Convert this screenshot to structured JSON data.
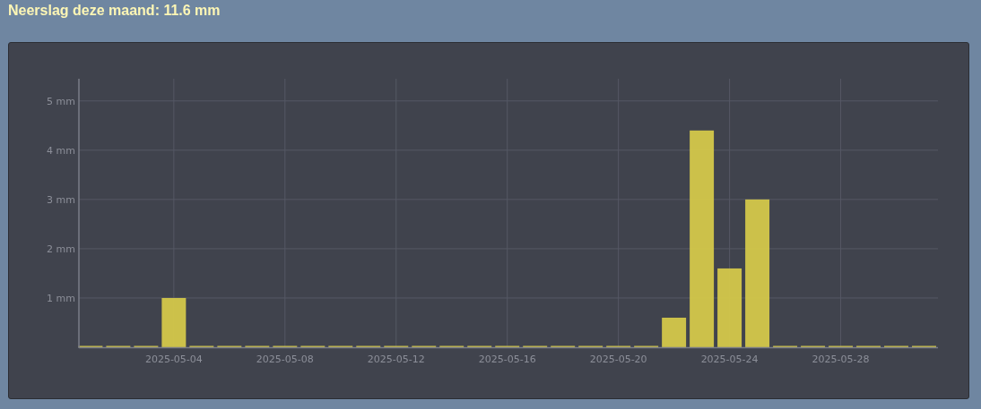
{
  "title": "Neerslag deze maand: 11.6 mm",
  "chart": {
    "chart_data": {
      "type": "bar",
      "x": [
        "2025-05-01",
        "2025-05-02",
        "2025-05-03",
        "2025-05-04",
        "2025-05-05",
        "2025-05-06",
        "2025-05-07",
        "2025-05-08",
        "2025-05-09",
        "2025-05-10",
        "2025-05-11",
        "2025-05-12",
        "2025-05-13",
        "2025-05-14",
        "2025-05-15",
        "2025-05-16",
        "2025-05-17",
        "2025-05-18",
        "2025-05-19",
        "2025-05-20",
        "2025-05-21",
        "2025-05-22",
        "2025-05-23",
        "2025-05-24",
        "2025-05-25",
        "2025-05-26",
        "2025-05-27",
        "2025-05-28",
        "2025-05-29",
        "2025-05-30",
        "2025-05-31"
      ],
      "series": [
        {
          "color": "#d4c84a",
          "values": [
            0,
            0,
            0,
            1.0,
            0,
            0,
            0,
            0,
            0,
            0,
            0,
            0,
            0,
            0,
            0,
            0,
            0,
            0,
            0,
            0,
            0,
            0.6,
            4.4,
            1.6,
            3.0,
            0,
            0,
            0,
            0,
            0,
            0
          ]
        }
      ],
      "ylim": [
        0,
        5.45
      ],
      "yticks": [
        {
          "value": 1,
          "label": "1 mm"
        },
        {
          "value": 2,
          "label": "2 mm"
        },
        {
          "value": 3,
          "label": "3 mm"
        },
        {
          "value": 4,
          "label": "4 mm"
        },
        {
          "value": 5,
          "label": "5 mm"
        }
      ],
      "xticks": [
        "2025-05-04",
        "2025-05-08",
        "2025-05-12",
        "2025-05-16",
        "2025-05-20",
        "2025-05-24",
        "2025-05-28"
      ],
      "xlim": [
        "2025-04-30T14:00:00Z",
        "2025-05-31T12:00:00Z"
      ],
      "grid": true
    }
  }
}
